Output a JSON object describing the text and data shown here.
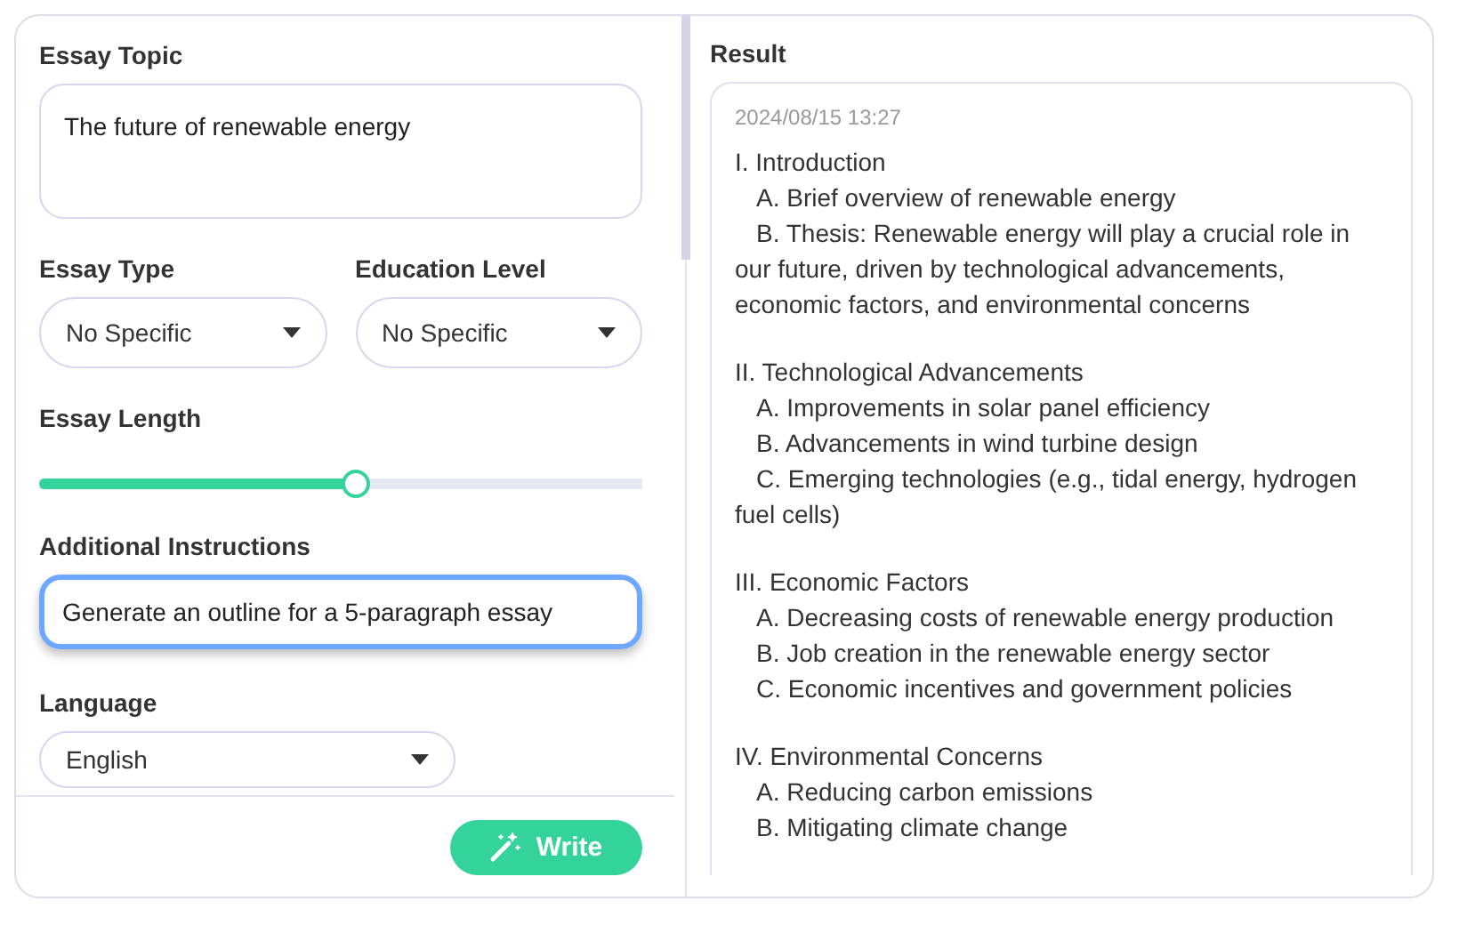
{
  "form": {
    "topic": {
      "label": "Essay Topic",
      "value": "The future of renewable energy"
    },
    "selects": [
      {
        "label": "Essay Type",
        "value": "No Specific"
      },
      {
        "label": "Education Level",
        "value": "No Specific"
      }
    ],
    "length": {
      "label": "Essay Length",
      "level": 0.524
    },
    "instructions": {
      "label": "Additional Instructions",
      "value": "Generate an outline for a 5-paragraph essay",
      "focused": true
    },
    "language": {
      "label": "Language",
      "value": "English"
    },
    "write_button": "Write"
  },
  "result": {
    "title": "Result",
    "timestamp": "2024/08/15 13:27",
    "sections": [
      {
        "heading": "I. Introduction",
        "items": [
          "A. Brief overview of renewable energy",
          "B. Thesis: Renewable energy will play a crucial role in our future, driven by technological advancements, economic factors, and environmental concerns"
        ]
      },
      {
        "heading": "II. Technological Advancements",
        "items": [
          "A. Improvements in solar panel efficiency",
          "B. Advancements in wind turbine design",
          "C. Emerging technologies (e.g., tidal energy, hydrogen fuel cells)"
        ]
      },
      {
        "heading": "III. Economic Factors",
        "items": [
          "A. Decreasing costs of renewable energy production",
          "B. Job creation in the renewable energy sector",
          "C. Economic incentives and government policies"
        ]
      },
      {
        "heading": "IV. Environmental Concerns",
        "items": [
          "A. Reducing carbon emissions",
          "B. Mitigating climate change"
        ]
      }
    ]
  }
}
